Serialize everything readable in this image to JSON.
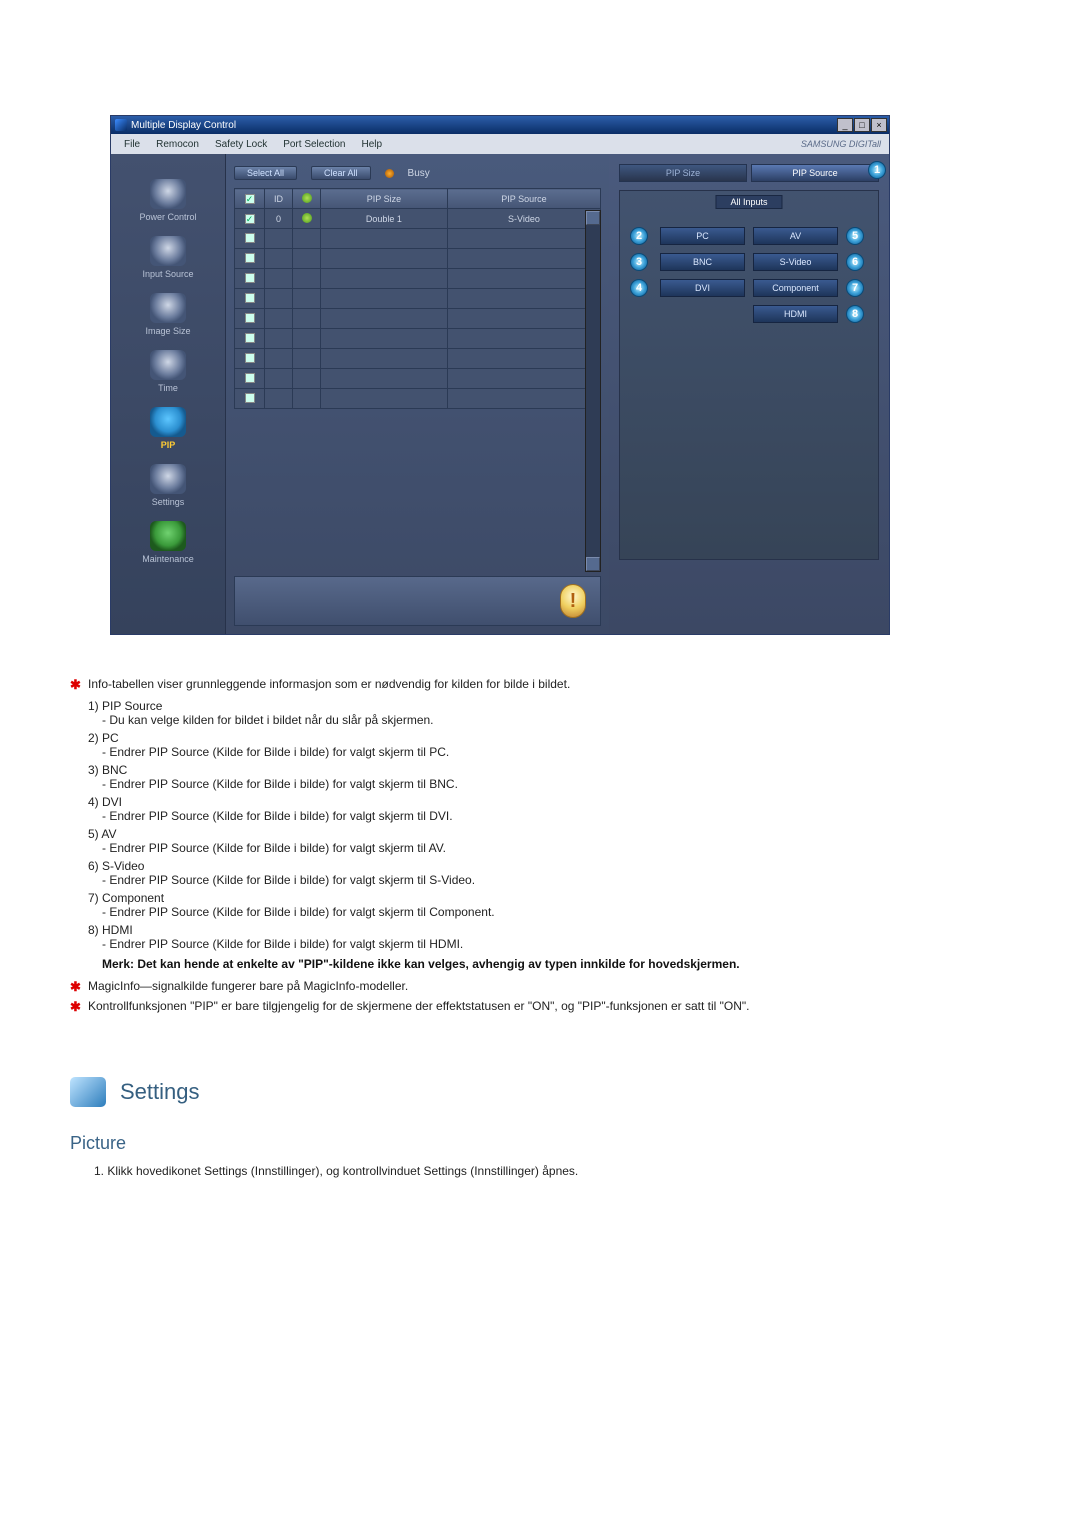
{
  "app": {
    "title": "Multiple Display Control",
    "menubar": [
      "File",
      "Remocon",
      "Safety Lock",
      "Port Selection",
      "Help"
    ],
    "brand": "SAMSUNG DIGITall",
    "toolbar": {
      "select_all": "Select All",
      "clear_all": "Clear All",
      "busy": "Busy"
    },
    "table": {
      "headers": [
        "",
        "ID",
        "",
        "PIP Size",
        "PIP Source"
      ],
      "rows": [
        {
          "checked": true,
          "id": "0",
          "status": "on",
          "pip_size": "Double 1",
          "pip_source": "S-Video"
        },
        {
          "checked": false,
          "id": "",
          "status": "",
          "pip_size": "",
          "pip_source": ""
        },
        {
          "checked": false,
          "id": "",
          "status": "",
          "pip_size": "",
          "pip_source": ""
        },
        {
          "checked": false,
          "id": "",
          "status": "",
          "pip_size": "",
          "pip_source": ""
        },
        {
          "checked": false,
          "id": "",
          "status": "",
          "pip_size": "",
          "pip_source": ""
        },
        {
          "checked": false,
          "id": "",
          "status": "",
          "pip_size": "",
          "pip_source": ""
        },
        {
          "checked": false,
          "id": "",
          "status": "",
          "pip_size": "",
          "pip_source": ""
        },
        {
          "checked": false,
          "id": "",
          "status": "",
          "pip_size": "",
          "pip_source": ""
        },
        {
          "checked": false,
          "id": "",
          "status": "",
          "pip_size": "",
          "pip_source": ""
        },
        {
          "checked": false,
          "id": "",
          "status": "",
          "pip_size": "",
          "pip_source": ""
        }
      ]
    },
    "sidebar": [
      {
        "label": "Power Control"
      },
      {
        "label": "Input Source"
      },
      {
        "label": "Image Size"
      },
      {
        "label": "Time"
      },
      {
        "label": "PIP"
      },
      {
        "label": "Settings"
      },
      {
        "label": "Maintenance"
      }
    ],
    "right": {
      "tabs": {
        "pip_size": "PIP Size",
        "pip_source": "PIP Source"
      },
      "panel_title": "All Inputs",
      "buttons": {
        "pc": "PC",
        "av": "AV",
        "bnc": "BNC",
        "svideo": "S-Video",
        "dvi": "DVI",
        "component": "Component",
        "hdmi": "HDMI"
      },
      "badges": {
        "b1": "1",
        "b2": "2",
        "b3": "3",
        "b4": "4",
        "b5": "5",
        "b6": "6",
        "b7": "7",
        "b8": "8"
      }
    }
  },
  "doc": {
    "intro": "Info-tabellen viser grunnleggende informasjon som er nødvendig for kilden for bilde i bildet.",
    "items": [
      {
        "n": "1)",
        "t": "PIP Source",
        "d": "Du kan velge kilden for bildet i bildet når du slår på skjermen."
      },
      {
        "n": "2)",
        "t": "PC",
        "d": "Endrer PIP Source (Kilde for Bilde i bilde) for valgt skjerm til PC."
      },
      {
        "n": "3)",
        "t": "BNC",
        "d": "Endrer PIP Source (Kilde for Bilde i bilde) for valgt skjerm til BNC."
      },
      {
        "n": "4)",
        "t": "DVI",
        "d": "Endrer PIP Source (Kilde for Bilde i bilde) for valgt skjerm til DVI."
      },
      {
        "n": "5)",
        "t": "AV",
        "d": "Endrer PIP Source (Kilde for Bilde i bilde) for valgt skjerm til AV."
      },
      {
        "n": "6)",
        "t": "S-Video",
        "d": "Endrer PIP Source (Kilde for Bilde i bilde) for valgt skjerm til S-Video."
      },
      {
        "n": "7)",
        "t": "Component",
        "d": "Endrer PIP Source (Kilde for Bilde i bilde) for valgt skjerm til Component."
      },
      {
        "n": "8)",
        "t": "HDMI",
        "d": "Endrer PIP Source (Kilde for Bilde i bilde) for valgt skjerm til HDMI."
      }
    ],
    "merk": "Merk: Det kan hende at enkelte av \"PIP\"-kildene ikke kan velges, avhengig av typen innkilde for hovedskjermen.",
    "note2": "MagicInfo—signalkilde fungerer bare på MagicInfo-modeller.",
    "note3": "Kontrollfunksjonen \"PIP\" er bare tilgjengelig for de skjermene der effektstatusen er \"ON\", og \"PIP\"-funksjonen er satt til \"ON\".",
    "section": {
      "title": "Settings",
      "sub": "Picture",
      "step1": "1. Klikk hovedikonet Settings (Innstillinger), og kontrollvinduet Settings (Innstillinger) åpnes."
    }
  }
}
